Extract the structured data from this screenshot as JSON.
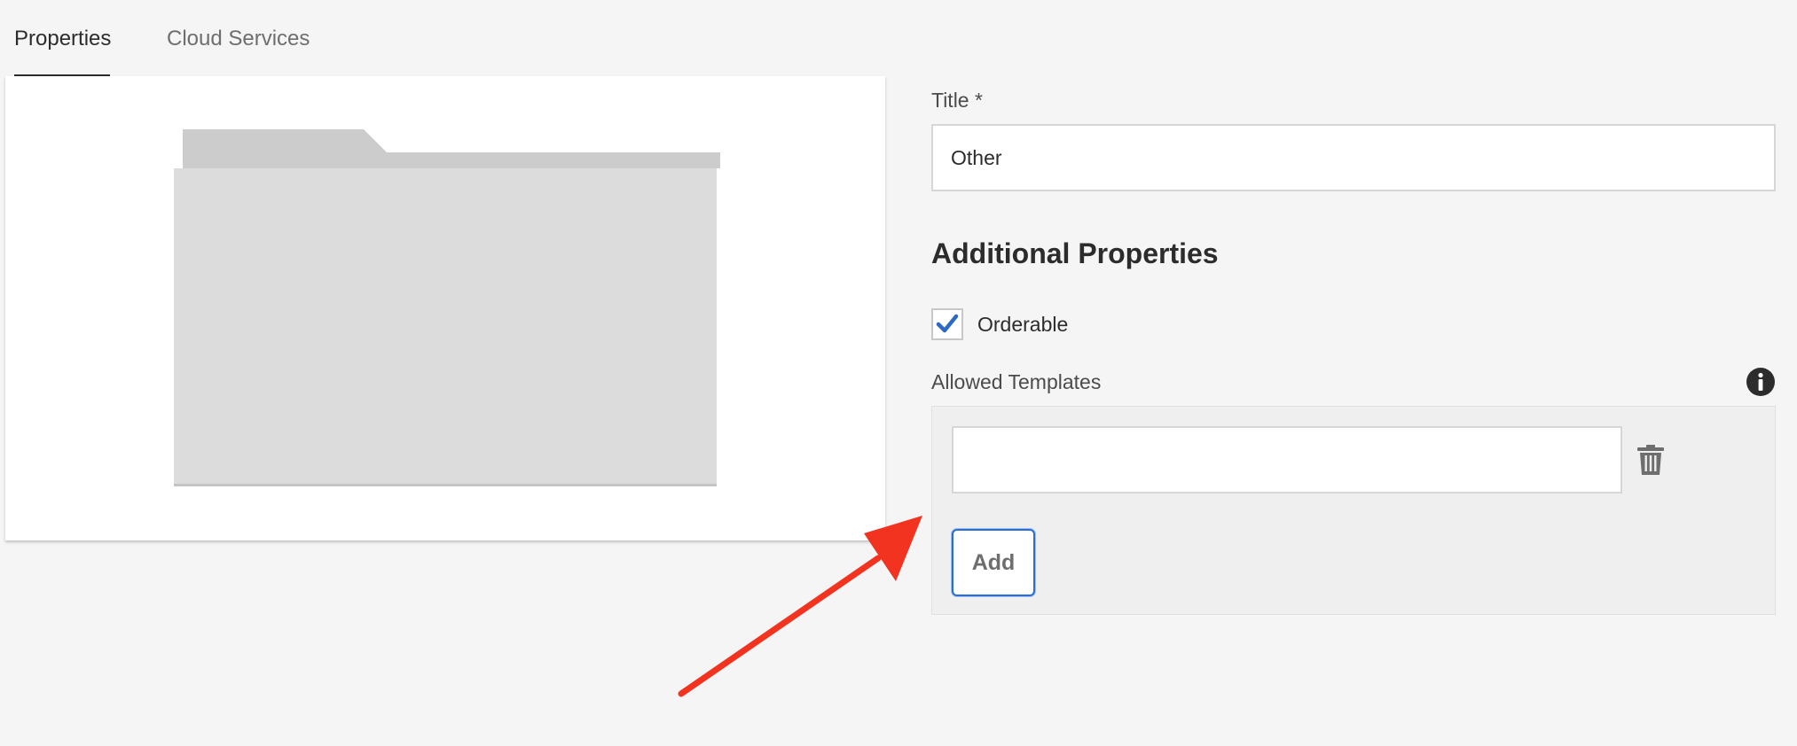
{
  "tabs": [
    {
      "label": "Properties",
      "active": true
    },
    {
      "label": "Cloud Services",
      "active": false
    }
  ],
  "thumbnail": {
    "icon": "folder-icon"
  },
  "form": {
    "title_label": "Title *",
    "title_value": "Other",
    "section_heading": "Additional Properties",
    "orderable": {
      "label": "Orderable",
      "checked": true
    },
    "allowed_templates": {
      "label": "Allowed Templates",
      "input_value": "",
      "add_label": "Add",
      "delete_icon": "trash-icon",
      "info_icon": "info-icon"
    }
  },
  "colors": {
    "accent": "#2a6ed6",
    "checkmark": "#2c68c4",
    "annotation_arrow": "#f2331f",
    "folder": "#dcdcdc",
    "folder_tab": "#cccccc"
  }
}
